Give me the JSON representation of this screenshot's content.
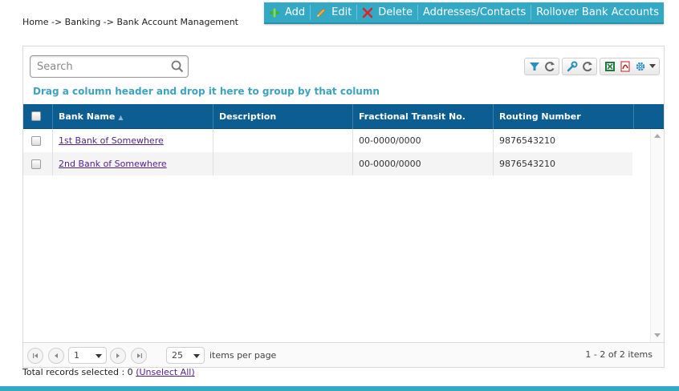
{
  "breadcrumb": "Home -> Banking -> Bank Account Management",
  "toolbar": {
    "add": "Add",
    "edit": "Edit",
    "delete": "Delete",
    "addresses": "Addresses/Contacts",
    "rollover": "Rollover Bank Accounts"
  },
  "search": {
    "placeholder": "Search"
  },
  "group_hint": "Drag a column header and drop it here to group by that column",
  "columns": {
    "bank_name": "Bank Name",
    "description": "Description",
    "fractional": "Fractional Transit No.",
    "routing": "Routing Number"
  },
  "rows": [
    {
      "bank_name": "1st Bank of Somewhere",
      "description": "",
      "fractional": "00-0000/0000",
      "routing": "9876543210"
    },
    {
      "bank_name": "2nd Bank of Somewhere",
      "description": "",
      "fractional": "00-0000/0000",
      "routing": "9876543210"
    }
  ],
  "pager": {
    "page": "1",
    "page_size": "25",
    "items_per_page": "items per page",
    "summary": "1 - 2 of 2 items"
  },
  "footer": {
    "selected_label": "Total records selected : 0",
    "unselect": "(Unselect All)"
  },
  "colors": {
    "accent": "#34a9c6",
    "header": "#0c5d92",
    "link": "#521f8b"
  },
  "icons": [
    "plus-icon",
    "pencil-icon",
    "delete-x-icon",
    "search-icon",
    "filter-icon",
    "refresh-icon",
    "wrench-icon",
    "excel-icon",
    "pdf-icon",
    "gear-icon"
  ]
}
